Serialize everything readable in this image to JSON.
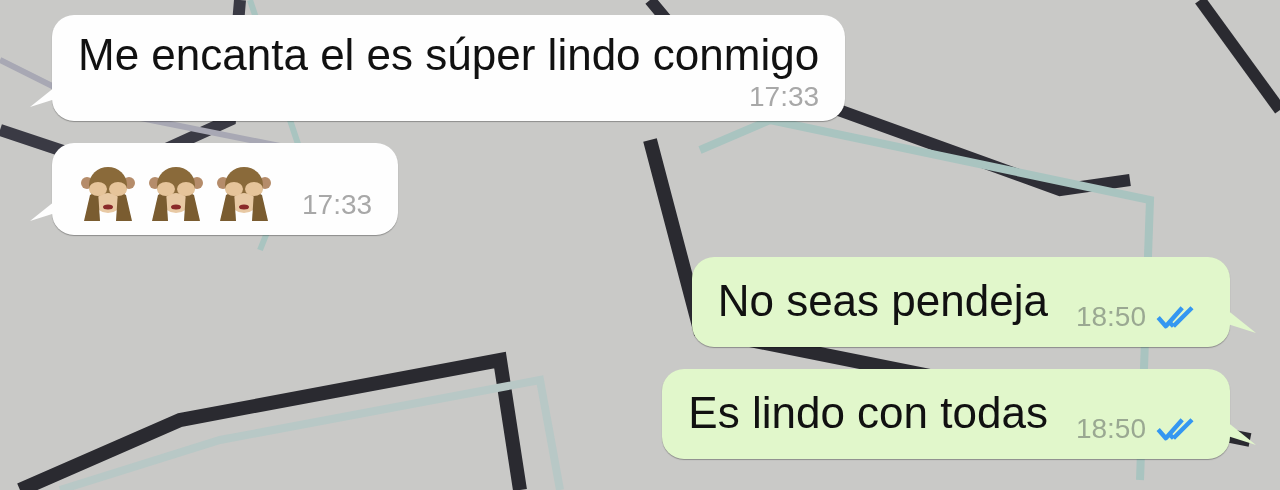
{
  "messages": [
    {
      "kind": "text",
      "outgoing": false,
      "text": "Me encanta el es súper lindo conmigo",
      "time": "17:33"
    },
    {
      "kind": "emoji",
      "outgoing": false,
      "emoji": [
        {
          "kind": "see-no-evil"
        },
        {
          "kind": "see-no-evil"
        },
        {
          "kind": "see-no-evil"
        }
      ],
      "time": "17:33"
    },
    {
      "kind": "text",
      "outgoing": true,
      "text": "No seas pendeja",
      "time": "18:50",
      "read": true
    },
    {
      "kind": "text",
      "outgoing": true,
      "text": "Es lindo con todas",
      "time": "18:50",
      "read": true
    }
  ]
}
